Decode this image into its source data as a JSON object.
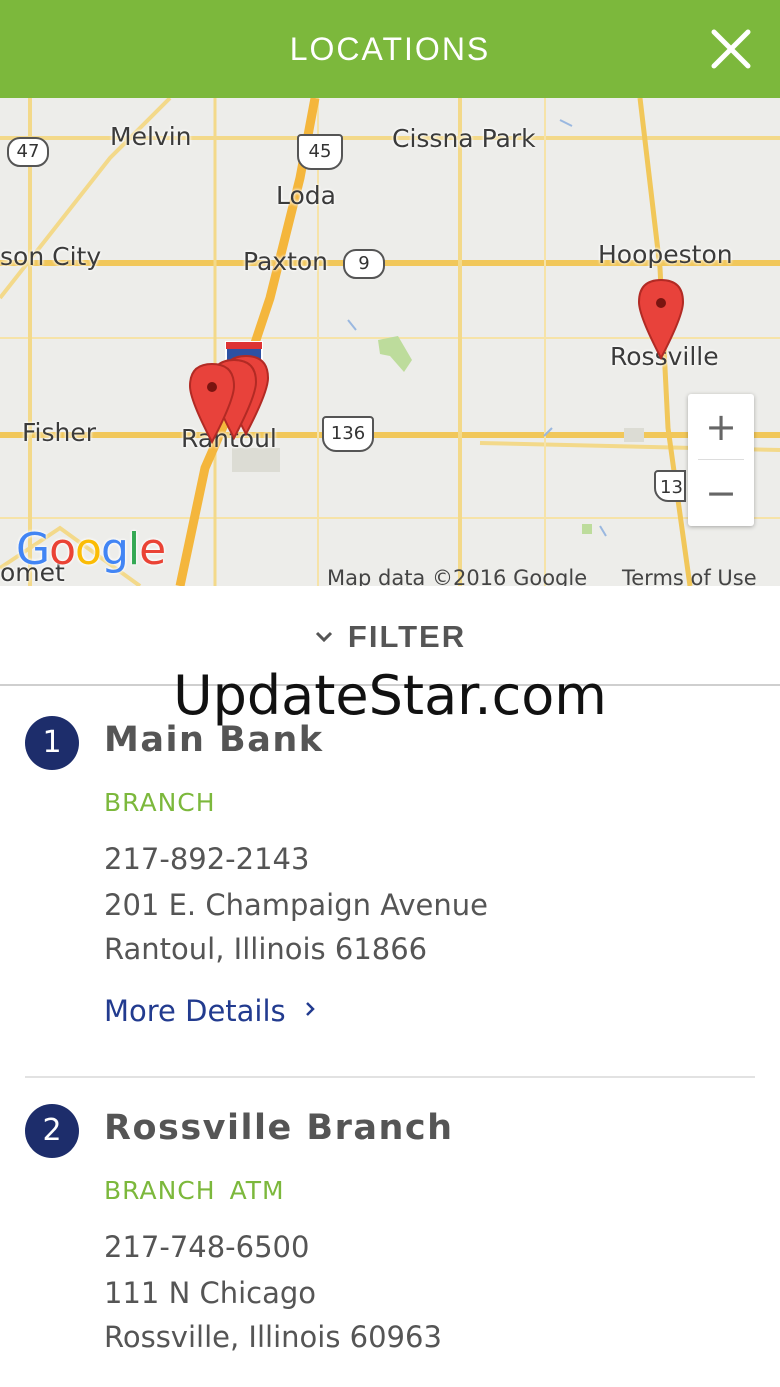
{
  "header": {
    "title": "LOCATIONS",
    "close_icon": "close-icon",
    "color": "#7cb83c"
  },
  "map": {
    "places": {
      "melvin": "Melvin",
      "cissna_park": "Cissna Park",
      "loda": "Loda",
      "gibson_city": "son City",
      "paxton": "Paxton",
      "hoopeston": "Hoopeston",
      "rossville": "Rossville",
      "fisher": "Fisher",
      "rantoul": "Rantoul",
      "mahomet": "omet"
    },
    "routes": {
      "r47": "47",
      "r45": "45",
      "r9": "9",
      "r136": "136",
      "r136_east": "13"
    },
    "zoom_in": "+",
    "zoom_out": "−",
    "logo": "Google",
    "attribution": "Map data ©2016 Google",
    "terms": "Terms of Use",
    "pin_color": "#e8423b"
  },
  "filter": {
    "label": "FILTER",
    "icon": "chevron-down-icon"
  },
  "watermark": "UpdateStar.com",
  "locations": [
    {
      "number": "1",
      "name": "Main Bank",
      "types": [
        "BRANCH"
      ],
      "phone": "217-892-2143",
      "street": "201 E. Champaign Avenue",
      "city": "Rantoul, Illinois 61866",
      "more": "More Details"
    },
    {
      "number": "2",
      "name": "Rossville Branch",
      "types": [
        "BRANCH",
        "ATM"
      ],
      "phone": "217-748-6500",
      "street": "111 N Chicago",
      "city": "Rossville, Illinois 60963"
    }
  ],
  "colors": {
    "accent": "#7cb83c",
    "badge": "#1d2d6b",
    "link": "#223b8f"
  }
}
